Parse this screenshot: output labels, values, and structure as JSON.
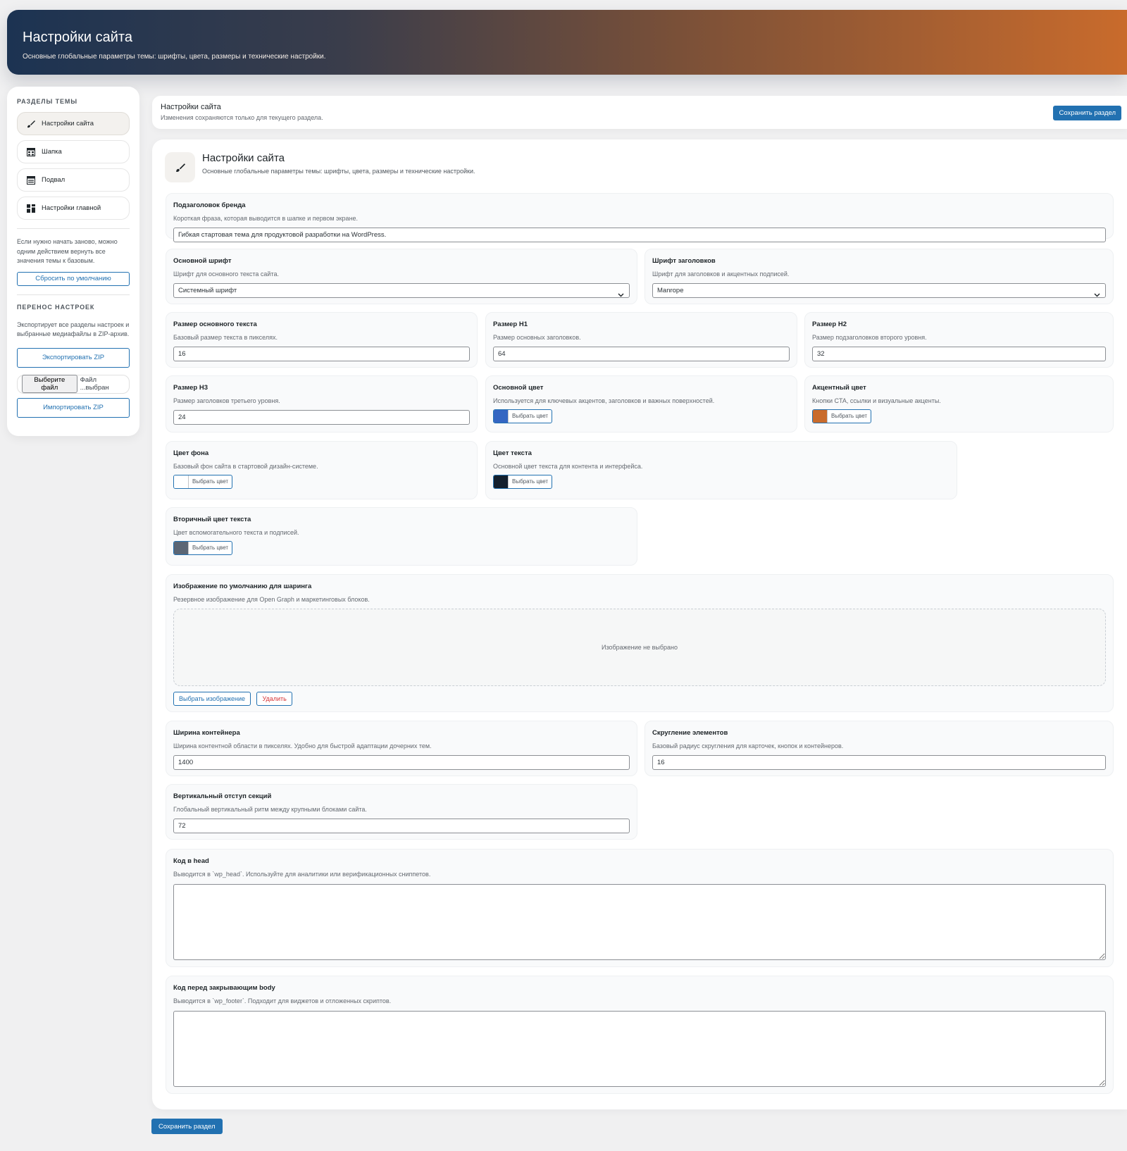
{
  "hero": {
    "title": "Настройки сайта",
    "subtitle": "Основные глобальные параметры темы: шрифты, цвета, размеры и технические настройки."
  },
  "sidebar": {
    "sections_heading": "РАЗДЕЛЫ ТЕМЫ",
    "items": [
      {
        "label": "Настройки сайта",
        "icon": "brush-icon",
        "active": true
      },
      {
        "label": "Шапка",
        "icon": "header-icon",
        "active": false
      },
      {
        "label": "Подвал",
        "icon": "footer-icon",
        "active": false
      },
      {
        "label": "Настройки главной",
        "icon": "grid-icon",
        "active": false
      }
    ],
    "reset_text": "Если нужно начать заново, можно одним действием вернуть все значения темы к базовым.",
    "reset_button": "Сбросить по умолчанию",
    "transfer_heading": "ПЕРЕНОС НАСТРОЕК",
    "transfer_text": "Экспортирует все разделы настроек и выбранные медиафайлы в ZIP-архив.",
    "export_button": "Экспортировать ZIP",
    "file_button": "Выберите файл",
    "file_status": "Файл ...выбран",
    "import_button": "Импортировать ZIP"
  },
  "bar": {
    "title": "Настройки сайта",
    "subtitle": "Изменения сохраняются только для текущего раздела.",
    "save_button": "Сохранить раздел"
  },
  "panel": {
    "title": "Настройки сайта",
    "subtitle": "Основные глобальные параметры темы: шрифты, цвета, размеры и технические настройки."
  },
  "fields": {
    "brand_subtitle": {
      "label": "Подзаголовок бренда",
      "desc": "Короткая фраза, которая выводится в шапке и первом экране.",
      "value": "Гибкая стартовая тема для продуктовой разработки на WordPress."
    },
    "body_font": {
      "label": "Основной шрифт",
      "desc": "Шрифт для основного текста сайта.",
      "value": "Системный шрифт"
    },
    "heading_font": {
      "label": "Шрифт заголовков",
      "desc": "Шрифт для заголовков и акцентных подписей.",
      "value": "Manrope"
    },
    "body_size": {
      "label": "Размер основного текста",
      "desc": "Базовый размер текста в пикселях.",
      "value": "16"
    },
    "h1_size": {
      "label": "Размер H1",
      "desc": "Размер основных заголовков.",
      "value": "64"
    },
    "h2_size": {
      "label": "Размер H2",
      "desc": "Размер подзаголовков второго уровня.",
      "value": "32"
    },
    "h3_size": {
      "label": "Размер H3",
      "desc": "Размер заголовков третьего уровня.",
      "value": "24"
    },
    "primary_color": {
      "label": "Основной цвет",
      "desc": "Используется для ключевых акцентов, заголовков и важных поверхностей.",
      "button": "Выбрать цвет",
      "color": "#3466c2"
    },
    "accent_color": {
      "label": "Акцентный цвет",
      "desc": "Кнопки CTA, ссылки и визуальные акценты.",
      "button": "Выбрать цвет",
      "color": "#c96b2c"
    },
    "bg_color": {
      "label": "Цвет фона",
      "desc": "Базовый фон сайта в стартовой дизайн-системе.",
      "button": "Выбрать цвет",
      "color": "#ffffff"
    },
    "text_color": {
      "label": "Цвет текста",
      "desc": "Основной цвет текста для контента и интерфейса.",
      "button": "Выбрать цвет",
      "color": "#14202e"
    },
    "secondary_text_color": {
      "label": "Вторичный цвет текста",
      "desc": "Цвет вспомогательного текста и подписей.",
      "button": "Выбрать цвет",
      "color": "#5b6675"
    },
    "share_image": {
      "label": "Изображение по умолчанию для шаринга",
      "desc": "Резервное изображение для Open Graph и маркетинговых блоков.",
      "empty": "Изображение не выбрано",
      "select_button": "Выбрать изображение",
      "remove_button": "Удалить"
    },
    "container_width": {
      "label": "Ширина контейнера",
      "desc": "Ширина контентной области в пикселях. Удобно для быстрой адаптации дочерних тем.",
      "value": "1400"
    },
    "radius": {
      "label": "Скругление элементов",
      "desc": "Базовый радиус скругления для карточек, кнопок и контейнеров.",
      "value": "16"
    },
    "section_spacing": {
      "label": "Вертикальный отступ секций",
      "desc": "Глобальный вертикальный ритм между крупными блоками сайта.",
      "value": "72"
    },
    "head_code": {
      "label": "Код в head",
      "desc": "Выводится в `wp_head`. Используйте для аналитики или верификационных сниппетов.",
      "value": ""
    },
    "body_code": {
      "label": "Код перед закрывающим body",
      "desc": "Выводится в `wp_footer`. Подходит для виджетов и отложенных скриптов.",
      "value": ""
    }
  },
  "footer": {
    "save_button": "Сохранить раздел"
  },
  "colors": {
    "brand_blue": "#2271b1",
    "hero_start": "#1c3352",
    "hero_end": "#c96b2c"
  }
}
